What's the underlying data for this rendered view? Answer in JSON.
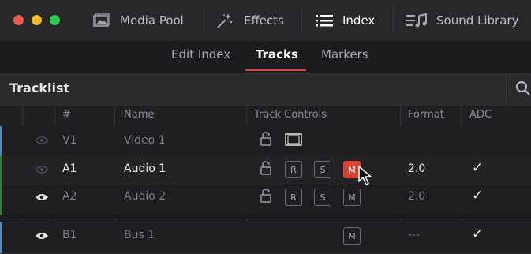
{
  "toolbar": {
    "items": [
      {
        "label": "Media Pool",
        "icon": "media-pool-icon"
      },
      {
        "label": "Effects",
        "icon": "effects-wand-icon"
      },
      {
        "label": "Index",
        "icon": "index-list-icon"
      },
      {
        "label": "Sound Library",
        "icon": "sound-library-icon"
      }
    ],
    "window_controls": {
      "close": "#ed5a50",
      "minimize": "#f2bc2f",
      "maximize": "#2fc84a"
    }
  },
  "tabs": [
    {
      "label": "Edit Index",
      "active": false
    },
    {
      "label": "Tracks",
      "active": true
    },
    {
      "label": "Markers",
      "active": false
    }
  ],
  "tracklist": {
    "title": "Tracklist",
    "search_icon": "search-icon",
    "columns": [
      "#",
      "Name",
      "Track Controls",
      "Format",
      "ADC"
    ],
    "rows": [
      {
        "id": "V1",
        "name": "Video 1",
        "visible": false,
        "controls": [
          "lock",
          "video-toggle"
        ],
        "format": "",
        "adc": false,
        "color": "#5b86b8"
      },
      {
        "id": "A1",
        "name": "Audio 1",
        "visible": false,
        "controls": [
          "lock",
          "R",
          "S",
          "M"
        ],
        "mute_on": true,
        "format": "2.0",
        "adc": true,
        "color": "#3f7a4a"
      },
      {
        "id": "A2",
        "name": "Audio 2",
        "visible": true,
        "controls": [
          "lock",
          "R",
          "S",
          "M"
        ],
        "mute_on": false,
        "format": "2.0",
        "adc": true,
        "color": "#3f7a4a"
      },
      {
        "id": "B1",
        "name": "Bus 1",
        "visible": true,
        "controls": [
          "M"
        ],
        "mute_on": false,
        "format": "---",
        "adc": true,
        "color": "#5b86b8"
      }
    ]
  },
  "labels": {
    "record": "R",
    "solo": "S",
    "mute": "M",
    "check": "✓"
  },
  "accent": "#d0493a"
}
